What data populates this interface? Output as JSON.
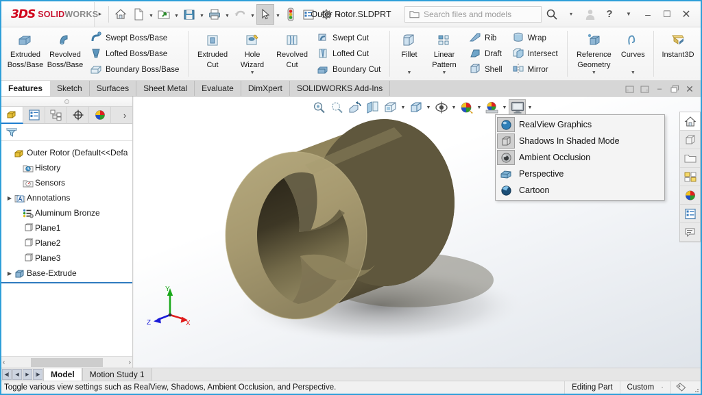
{
  "window": {
    "brand_3ds": "3DS",
    "brand_solid": "SOLID",
    "brand_works": "WORKS",
    "document_title": "Outer Rotor.SLDPRT",
    "accent_color": "#2e9fd9",
    "minimize": "–",
    "maximize": "☐",
    "close": "✕"
  },
  "search": {
    "placeholder": "Search files and models",
    "folder_icon": "folder-icon",
    "magnifier_icon": "search-icon",
    "dropdown_caret": "▾"
  },
  "quick_access": [
    {
      "name": "home-button",
      "icon": "home-icon"
    },
    {
      "name": "new-document-button",
      "icon": "new-file-icon",
      "caret": true
    },
    {
      "name": "open-document-button",
      "icon": "open-folder-icon",
      "caret": true
    },
    {
      "name": "save-button",
      "icon": "save-icon",
      "caret": true
    },
    {
      "name": "print-button",
      "icon": "print-icon",
      "caret": true
    },
    {
      "name": "undo-button",
      "icon": "undo-icon",
      "caret": true
    },
    {
      "name": "select-button",
      "icon": "arrow-cursor-icon",
      "caret": true,
      "selected": true
    },
    {
      "name": "rebuild-button",
      "icon": "traffic-light-icon"
    },
    {
      "name": "file-properties-button",
      "icon": "properties-icon"
    },
    {
      "name": "options-button",
      "icon": "gear-icon",
      "caret": true
    }
  ],
  "ribbon": {
    "groups": [
      {
        "name": "boss-base-group",
        "big": [
          {
            "label_line1": "Extruded",
            "label_line2": "Boss/Base",
            "icon": "extruded-boss-icon"
          },
          {
            "label_line1": "Revolved",
            "label_line2": "Boss/Base",
            "icon": "revolved-boss-icon"
          }
        ],
        "small": [
          {
            "label": "Swept Boss/Base",
            "icon": "swept-boss-icon"
          },
          {
            "label": "Lofted Boss/Base",
            "icon": "lofted-boss-icon"
          },
          {
            "label": "Boundary Boss/Base",
            "icon": "boundary-boss-icon"
          }
        ]
      },
      {
        "name": "cut-group",
        "big": [
          {
            "label_line1": "Extruded",
            "label_line2": "Cut",
            "icon": "extruded-cut-icon"
          },
          {
            "label_line1": "Hole",
            "label_line2": "Wizard",
            "icon": "hole-wizard-icon",
            "dropdown": true
          },
          {
            "label_line1": "Revolved",
            "label_line2": "Cut",
            "icon": "revolved-cut-icon"
          }
        ],
        "small": [
          {
            "label": "Swept Cut",
            "icon": "swept-cut-icon"
          },
          {
            "label": "Lofted Cut",
            "icon": "lofted-cut-icon"
          },
          {
            "label": "Boundary Cut",
            "icon": "boundary-cut-icon"
          }
        ]
      },
      {
        "name": "fillet-pattern-group",
        "big": [
          {
            "label_line1": "Fillet",
            "label_line2": "",
            "icon": "fillet-icon",
            "dropdown": true
          },
          {
            "label_line1": "Linear",
            "label_line2": "Pattern",
            "icon": "linear-pattern-icon",
            "dropdown": true
          }
        ],
        "small": [
          {
            "label": "Rib",
            "icon": "rib-icon"
          },
          {
            "label": "Draft",
            "icon": "draft-icon"
          },
          {
            "label": "Shell",
            "icon": "shell-icon"
          }
        ]
      },
      {
        "name": "wrap-group",
        "big": [],
        "small": [
          {
            "label": "Wrap",
            "icon": "wrap-icon"
          },
          {
            "label": "Intersect",
            "icon": "intersect-icon"
          },
          {
            "label": "Mirror",
            "icon": "mirror-icon"
          }
        ]
      },
      {
        "name": "reference-group",
        "big": [
          {
            "label_line1": "Reference",
            "label_line2": "Geometry",
            "icon": "reference-geometry-icon",
            "dropdown": true
          },
          {
            "label_line1": "Curves",
            "label_line2": "",
            "icon": "curves-icon",
            "dropdown": true
          }
        ],
        "small": []
      },
      {
        "name": "instant3d-group",
        "big": [
          {
            "label_line1": "Instant3D",
            "label_line2": "",
            "icon": "instant3d-icon"
          }
        ],
        "small": []
      }
    ]
  },
  "command_tabs": {
    "items": [
      {
        "label": "Features",
        "active": true
      },
      {
        "label": "Sketch",
        "active": false
      },
      {
        "label": "Surfaces",
        "active": false
      },
      {
        "label": "Sheet Metal",
        "active": false
      },
      {
        "label": "Evaluate",
        "active": false
      },
      {
        "label": "DimXpert",
        "active": false
      },
      {
        "label": "SOLIDWORKS Add-Ins",
        "active": false
      }
    ],
    "window_buttons": [
      {
        "name": "restore-left-button",
        "glyph": "▣"
      },
      {
        "name": "restore-right-button",
        "glyph": "▣"
      },
      {
        "name": "doc-minimize-button",
        "glyph": "–"
      },
      {
        "name": "doc-restore-button",
        "glyph": "❐"
      },
      {
        "name": "doc-close-button",
        "glyph": "✕"
      }
    ]
  },
  "left_panel": {
    "tabs": [
      {
        "name": "feature-manager-tab",
        "icon": "feature-tree-icon",
        "active": true
      },
      {
        "name": "property-manager-tab",
        "icon": "property-list-icon",
        "active": false
      },
      {
        "name": "configuration-manager-tab",
        "icon": "configuration-icon",
        "active": false
      },
      {
        "name": "dimxpert-manager-tab",
        "icon": "crosshair-icon",
        "active": false
      },
      {
        "name": "display-manager-tab",
        "icon": "color-wheel-icon",
        "active": false
      }
    ],
    "more_glyph": "›",
    "filter_icon": "filter-icon",
    "tree": [
      {
        "label": "Outer Rotor  (Default<<Defa",
        "icon": "part-icon",
        "level": 0,
        "expandable": false
      },
      {
        "label": "History",
        "icon": "history-icon",
        "level": 1,
        "expandable": false
      },
      {
        "label": "Sensors",
        "icon": "sensors-icon",
        "level": 1,
        "expandable": false
      },
      {
        "label": "Annotations",
        "icon": "annotations-icon",
        "level": 1,
        "expandable": true
      },
      {
        "label": "Aluminum Bronze",
        "icon": "material-icon",
        "level": 1,
        "expandable": false
      },
      {
        "label": "Plane1",
        "icon": "plane-icon",
        "level": 1,
        "expandable": false
      },
      {
        "label": "Plane2",
        "icon": "plane-icon",
        "level": 1,
        "expandable": false
      },
      {
        "label": "Plane3",
        "icon": "plane-icon",
        "level": 1,
        "expandable": false
      },
      {
        "label": "Base-Extrude",
        "icon": "extrude-feature-icon",
        "level": 1,
        "expandable": true
      }
    ],
    "scroll_left": "‹",
    "scroll_right": "›"
  },
  "view_toolbar": {
    "buttons": [
      {
        "name": "zoom-to-fit-button",
        "icon": "zoom-fit-icon"
      },
      {
        "name": "zoom-to-area-button",
        "icon": "zoom-area-icon"
      },
      {
        "name": "previous-view-button",
        "icon": "previous-view-icon"
      },
      {
        "name": "section-view-button",
        "icon": "section-view-icon"
      },
      {
        "name": "view-orientation-button",
        "icon": "view-orientation-icon",
        "caret": true
      },
      {
        "name": "display-style-button",
        "icon": "display-style-icon",
        "caret": true
      },
      {
        "name": "hide-show-items-button",
        "icon": "hide-show-icon",
        "caret": true
      },
      {
        "name": "edit-appearance-button",
        "icon": "appearance-icon",
        "caret": true
      },
      {
        "name": "apply-scene-button",
        "icon": "scene-icon",
        "caret": true
      },
      {
        "name": "view-settings-button",
        "icon": "monitor-icon",
        "caret": true,
        "pressed": true
      }
    ]
  },
  "view_settings_menu": {
    "items": [
      {
        "label": "RealView Graphics",
        "icon": "realview-sphere-icon",
        "toggled": true
      },
      {
        "label": "Shadows In Shaded Mode",
        "icon": "shadow-cube-icon",
        "toggled": true
      },
      {
        "label": "Ambient Occlusion",
        "icon": "ambient-occlusion-icon",
        "toggled": true
      },
      {
        "label": "Perspective",
        "icon": "perspective-icon",
        "toggled": false
      },
      {
        "label": "Cartoon",
        "icon": "cartoon-sphere-icon",
        "toggled": false
      }
    ]
  },
  "right_toolbar": {
    "buttons": [
      {
        "name": "view-palette-home-button",
        "icon": "home-icon",
        "active": true
      },
      {
        "name": "appearances-button",
        "icon": "box-icon",
        "active": false
      },
      {
        "name": "file-explorer-button",
        "icon": "folder-icon",
        "active": false
      },
      {
        "name": "view-palette-button",
        "icon": "view-palette-icon",
        "active": false
      },
      {
        "name": "appearances-scenes-button",
        "icon": "color-wheel-icon",
        "active": false
      },
      {
        "name": "custom-properties-button",
        "icon": "properties-icon",
        "active": false
      },
      {
        "name": "annotation-button",
        "icon": "comment-icon",
        "active": false
      }
    ]
  },
  "triad": {
    "x_label": "X",
    "y_label": "Y",
    "z_label": "Z",
    "x_color": "#e01b1b",
    "y_color": "#1aa81a",
    "z_color": "#1a1ad8"
  },
  "model": {
    "name": "outer-rotor-3d-model",
    "body_color": "#8b7f58",
    "body_color_light": "#b5a77a",
    "body_color_dark": "#4a4330"
  },
  "bottom_tabs": {
    "nav_buttons": [
      "⏮",
      "◀",
      "▶",
      "⏭"
    ],
    "items": [
      {
        "label": "Model",
        "active": true
      },
      {
        "label": "Motion Study 1",
        "active": false
      }
    ]
  },
  "status_bar": {
    "message": "Toggle various view settings such as RealView, Shadows, Ambient Occlusion, and Perspective.",
    "editing_state": "Editing Part",
    "units": "Custom",
    "units_caret": "·",
    "tag_icon": "tag-icon"
  }
}
